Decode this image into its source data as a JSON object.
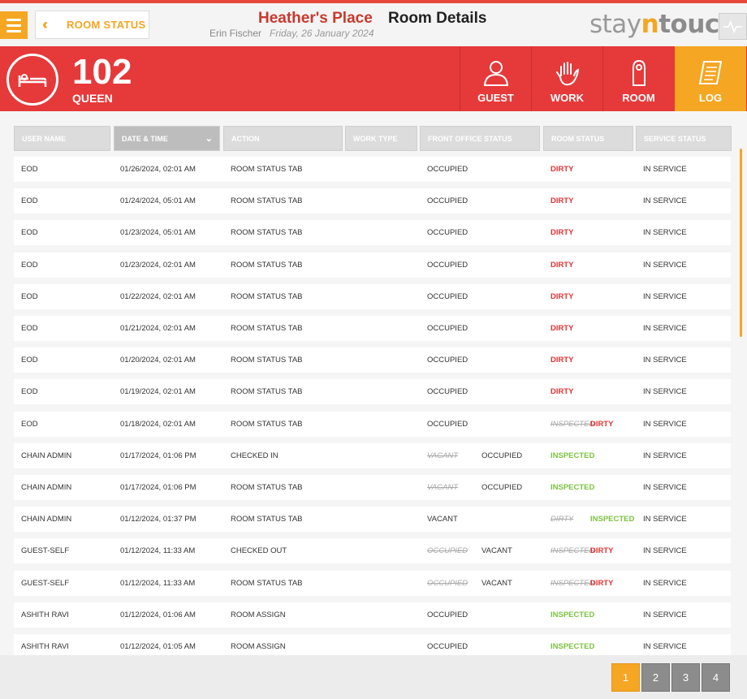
{
  "header": {
    "back_label": "ROOM STATUS",
    "hotel_name": "Heather's Place",
    "page_title": "Room Details",
    "user_name": "Erin Fischer",
    "date": "Friday, 26 January 2024",
    "logo": {
      "part1": "stay",
      "part2": "n",
      "part3": "touch"
    }
  },
  "room": {
    "number": "102",
    "type": "QUEEN",
    "tabs": [
      {
        "label": "GUEST",
        "icon": "guest-icon"
      },
      {
        "label": "WORK",
        "icon": "hand-icon"
      },
      {
        "label": "ROOM",
        "icon": "door-hanger-icon"
      },
      {
        "label": "LOG",
        "icon": "log-icon",
        "active": true
      }
    ]
  },
  "table": {
    "columns": [
      "USER NAME",
      "DATE & TIME",
      "ACTION",
      "WORK TYPE",
      "FRONT OFFICE STATUS",
      "ROOM STATUS",
      "SERVICE STATUS"
    ],
    "sorted_column": "DATE & TIME",
    "rows": [
      {
        "user": "EOD",
        "datetime": "01/26/2024, 02:01 AM",
        "action": "ROOM STATUS TAB",
        "work_type": "",
        "fo_old": "",
        "fo_new": "OCCUPIED",
        "rs_old": "",
        "rs_new": "DIRTY",
        "rs_new_status": "dirty",
        "service": "IN SERVICE"
      },
      {
        "user": "EOD",
        "datetime": "01/24/2024, 05:01 AM",
        "action": "ROOM STATUS TAB",
        "work_type": "",
        "fo_old": "",
        "fo_new": "OCCUPIED",
        "rs_old": "",
        "rs_new": "DIRTY",
        "rs_new_status": "dirty",
        "service": "IN SERVICE"
      },
      {
        "user": "EOD",
        "datetime": "01/23/2024, 05:01 AM",
        "action": "ROOM STATUS TAB",
        "work_type": "",
        "fo_old": "",
        "fo_new": "OCCUPIED",
        "rs_old": "",
        "rs_new": "DIRTY",
        "rs_new_status": "dirty",
        "service": "IN SERVICE"
      },
      {
        "user": "EOD",
        "datetime": "01/23/2024, 02:01 AM",
        "action": "ROOM STATUS TAB",
        "work_type": "",
        "fo_old": "",
        "fo_new": "OCCUPIED",
        "rs_old": "",
        "rs_new": "DIRTY",
        "rs_new_status": "dirty",
        "service": "IN SERVICE"
      },
      {
        "user": "EOD",
        "datetime": "01/22/2024, 02:01 AM",
        "action": "ROOM STATUS TAB",
        "work_type": "",
        "fo_old": "",
        "fo_new": "OCCUPIED",
        "rs_old": "",
        "rs_new": "DIRTY",
        "rs_new_status": "dirty",
        "service": "IN SERVICE"
      },
      {
        "user": "EOD",
        "datetime": "01/21/2024, 02:01 AM",
        "action": "ROOM STATUS TAB",
        "work_type": "",
        "fo_old": "",
        "fo_new": "OCCUPIED",
        "rs_old": "",
        "rs_new": "DIRTY",
        "rs_new_status": "dirty",
        "service": "IN SERVICE"
      },
      {
        "user": "EOD",
        "datetime": "01/20/2024, 02:01 AM",
        "action": "ROOM STATUS TAB",
        "work_type": "",
        "fo_old": "",
        "fo_new": "OCCUPIED",
        "rs_old": "",
        "rs_new": "DIRTY",
        "rs_new_status": "dirty",
        "service": "IN SERVICE"
      },
      {
        "user": "EOD",
        "datetime": "01/19/2024, 02:01 AM",
        "action": "ROOM STATUS TAB",
        "work_type": "",
        "fo_old": "",
        "fo_new": "OCCUPIED",
        "rs_old": "",
        "rs_new": "DIRTY",
        "rs_new_status": "dirty",
        "service": "IN SERVICE"
      },
      {
        "user": "EOD",
        "datetime": "01/18/2024, 02:01 AM",
        "action": "ROOM STATUS TAB",
        "work_type": "",
        "fo_old": "",
        "fo_new": "OCCUPIED",
        "rs_old": "INSPECTED",
        "rs_new": "DIRTY",
        "rs_new_status": "dirty",
        "service": "IN SERVICE"
      },
      {
        "user": "CHAIN ADMIN",
        "datetime": "01/17/2024, 01:06 PM",
        "action": "CHECKED IN",
        "work_type": "",
        "fo_old": "VACANT",
        "fo_new": "OCCUPIED",
        "rs_old": "",
        "rs_new": "INSPECTED",
        "rs_new_status": "inspected",
        "service": "IN SERVICE"
      },
      {
        "user": "CHAIN ADMIN",
        "datetime": "01/17/2024, 01:06 PM",
        "action": "ROOM STATUS TAB",
        "work_type": "",
        "fo_old": "VACANT",
        "fo_new": "OCCUPIED",
        "rs_old": "",
        "rs_new": "INSPECTED",
        "rs_new_status": "inspected",
        "service": "IN SERVICE"
      },
      {
        "user": "CHAIN ADMIN",
        "datetime": "01/12/2024, 01:37 PM",
        "action": "ROOM STATUS TAB",
        "work_type": "",
        "fo_old": "",
        "fo_new": "VACANT",
        "rs_old": "DIRTY",
        "rs_new": "INSPECTED",
        "rs_new_status": "inspected",
        "service": "IN SERVICE"
      },
      {
        "user": "GUEST-SELF",
        "datetime": "01/12/2024, 11:33 AM",
        "action": "CHECKED OUT",
        "work_type": "",
        "fo_old": "OCCUPIED",
        "fo_new": "VACANT",
        "rs_old": "INSPECTED",
        "rs_new": "DIRTY",
        "rs_new_status": "dirty",
        "service": "IN SERVICE"
      },
      {
        "user": "GUEST-SELF",
        "datetime": "01/12/2024, 11:33 AM",
        "action": "ROOM STATUS TAB",
        "work_type": "",
        "fo_old": "OCCUPIED",
        "fo_new": "VACANT",
        "rs_old": "INSPECTED",
        "rs_new": "DIRTY",
        "rs_new_status": "dirty",
        "service": "IN SERVICE"
      },
      {
        "user": "ASHITH RAVI",
        "datetime": "01/12/2024, 01:06 AM",
        "action": "ROOM ASSIGN",
        "work_type": "",
        "fo_old": "",
        "fo_new": "OCCUPIED",
        "rs_old": "",
        "rs_new": "INSPECTED",
        "rs_new_status": "inspected",
        "service": "IN SERVICE"
      },
      {
        "user": "ASHITH RAVI",
        "datetime": "01/12/2024, 01:05 AM",
        "action": "ROOM ASSIGN",
        "work_type": "",
        "fo_old": "",
        "fo_new": "OCCUPIED",
        "rs_old": "",
        "rs_new": "INSPECTED",
        "rs_new_status": "inspected",
        "service": "IN SERVICE"
      }
    ]
  },
  "pagination": {
    "pages": [
      "1",
      "2",
      "3",
      "4"
    ],
    "active": "1"
  },
  "colors": {
    "red": "#e6393a",
    "orange": "#f5a623",
    "dirty": "#e23434",
    "inspected": "#7dc242"
  }
}
